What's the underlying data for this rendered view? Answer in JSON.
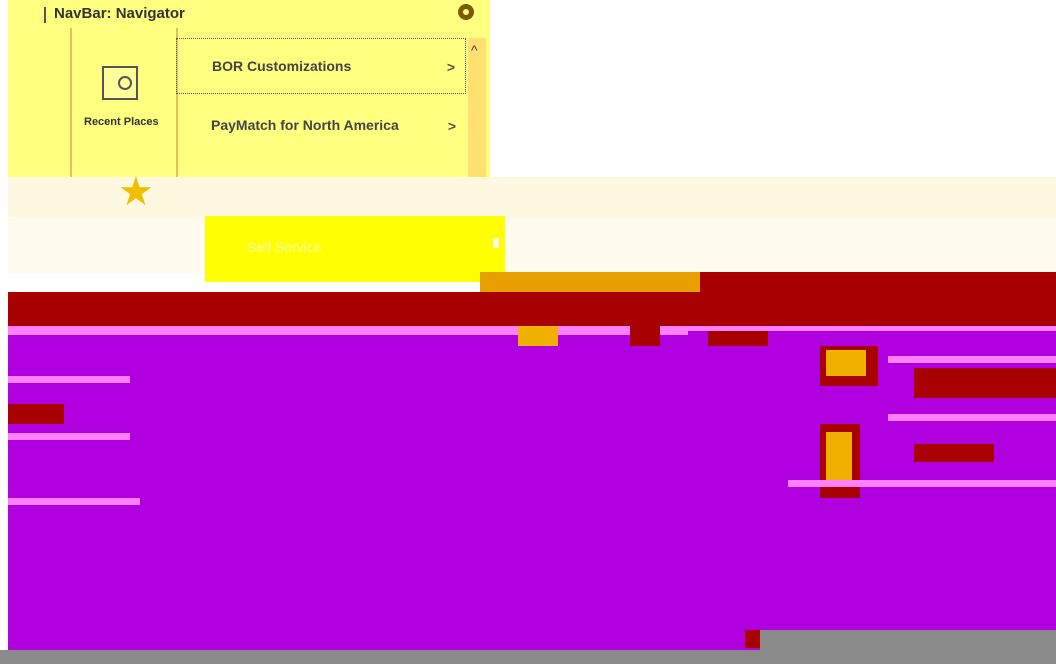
{
  "navbar": {
    "title": "NavBar: Navigator",
    "recent_label": "Recent Places",
    "items": [
      {
        "label": "BOR Customizations",
        "selected": true
      },
      {
        "label": "PayMatch for North America",
        "selected": false
      }
    ]
  },
  "self_service": {
    "label": "Self Service"
  },
  "colors": {
    "navbar_bg": "#ffff80",
    "red_band": "#a80000",
    "main_bg": "#b000e0",
    "accent_pink": "#ff80ff",
    "gold": "#f0b000"
  },
  "icons": {
    "gear": "gear-icon",
    "recent": "clock-calendar-icon",
    "star": "star-icon",
    "chevron": "chevron-right-icon",
    "scroll_up": "chevron-up-icon"
  }
}
